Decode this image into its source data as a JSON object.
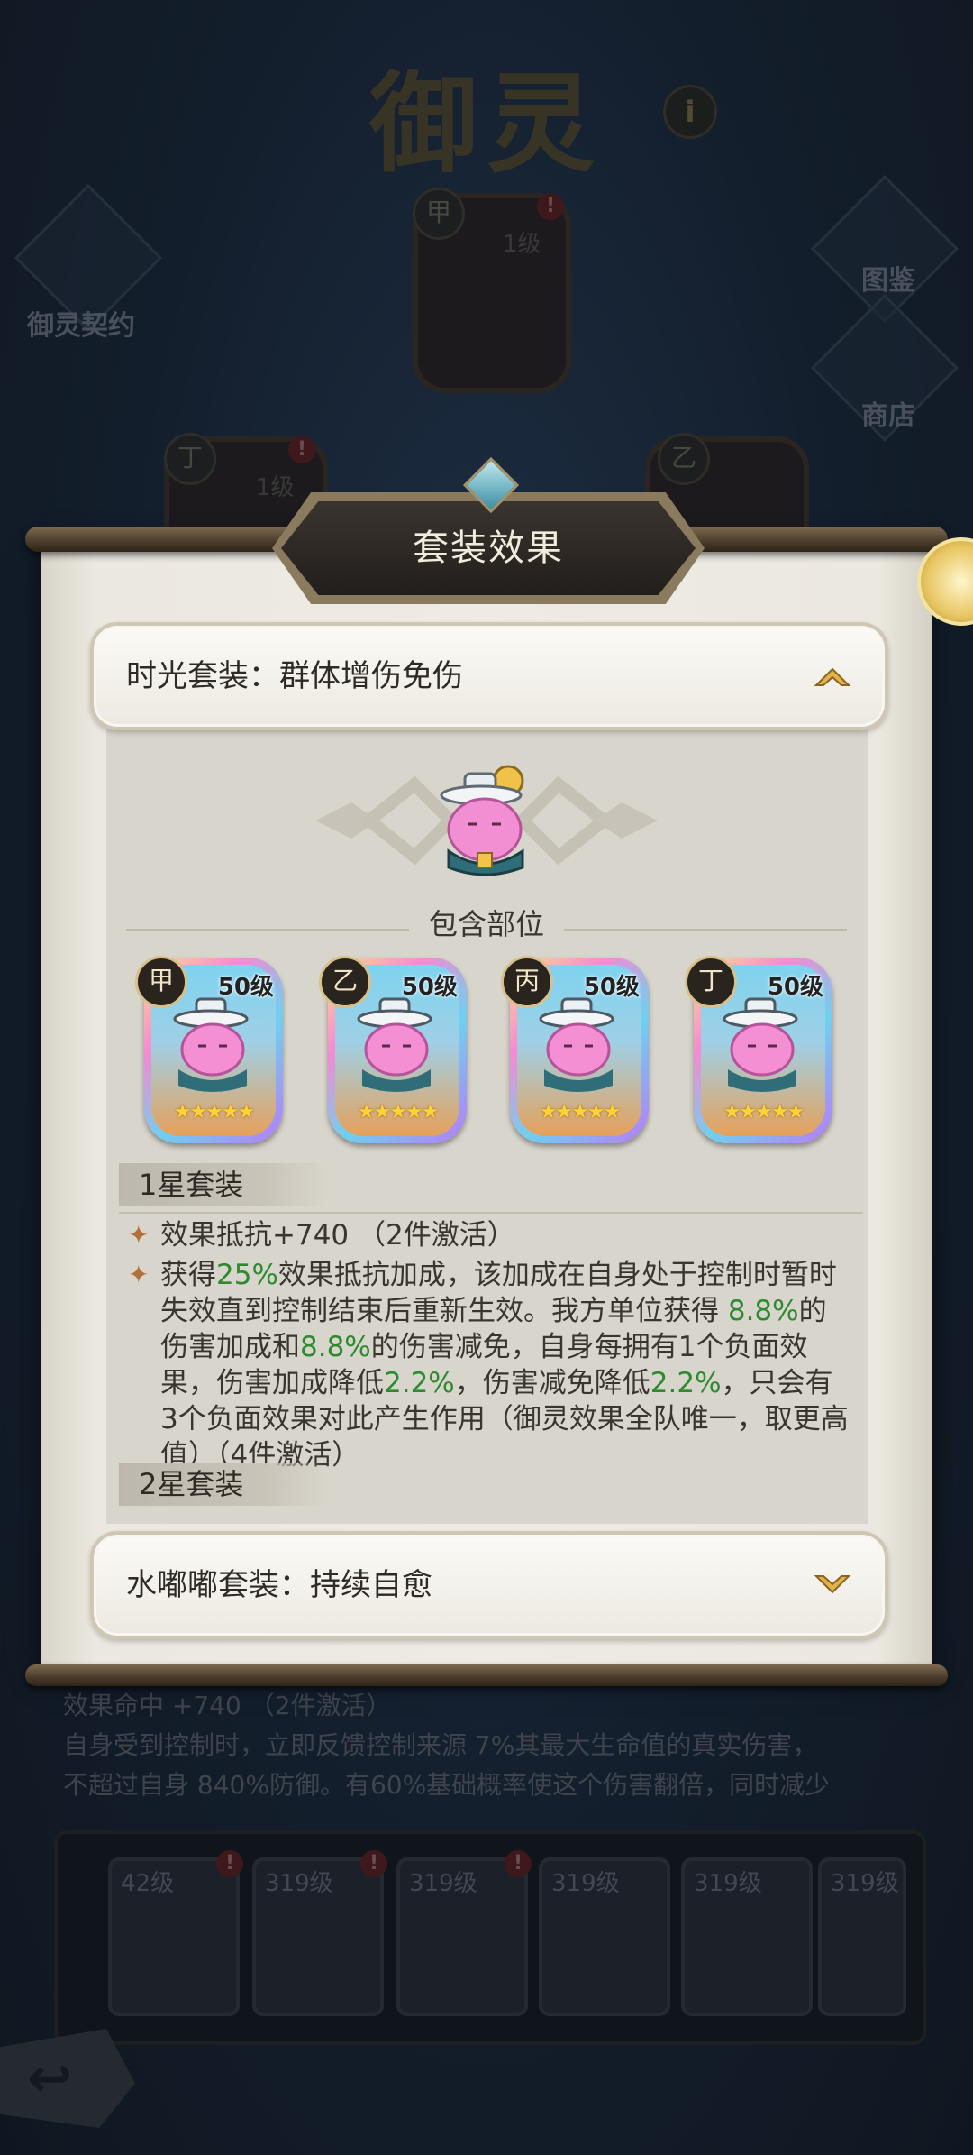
{
  "background": {
    "title": "御灵",
    "info_icon": "info-icon",
    "left_side": {
      "label": "御灵契约"
    },
    "right_side": [
      {
        "label": "图鉴",
        "icon": "book-icon"
      },
      {
        "label": "商店",
        "icon": "bag-icon"
      }
    ],
    "slots": [
      {
        "tag": "甲",
        "level": "1级"
      },
      {
        "tag": "丁",
        "level": "1级"
      },
      {
        "tag": "乙",
        "level": ""
      }
    ],
    "lower_lines": [
      "效果命中 +740 （2件激活）",
      "自身受到控制时，立即反馈控制来源 7%其最大生命值的真实伤害，",
      "不超过自身 840%防御。有60%基础概率使这个伤害翻倍，同时减少"
    ],
    "tray": [
      {
        "level": "42级",
        "badge": "!"
      },
      {
        "level": "319级",
        "badge": "!"
      },
      {
        "level": "319级",
        "badge": "!"
      },
      {
        "level": "319级",
        "badge": ""
      },
      {
        "level": "319级",
        "badge": ""
      },
      {
        "level": "319级",
        "badge": ""
      }
    ]
  },
  "dialog": {
    "title": "套装效果",
    "set1": {
      "name": "时光套装：群体增伤免伤",
      "state": "expanded"
    },
    "contains_label": "包含部位",
    "pieces": [
      {
        "tag": "甲",
        "level": "50级",
        "stars": "★★★★★"
      },
      {
        "tag": "乙",
        "level": "50级",
        "stars": "★★★★★"
      },
      {
        "tag": "丙",
        "level": "50级",
        "stars": "★★★★★"
      },
      {
        "tag": "丁",
        "level": "50级",
        "stars": "★★★★★"
      }
    ],
    "star1_header": "1星套装",
    "effect1": "效果抵抗+740 （2件激活）",
    "effect2": {
      "t1": "获得",
      "g1": "25%",
      "t2": "效果抵抗加成，该加成在自身处于控制时暂时失效直到控制结束后重新生效。我方单位获得 ",
      "g2": "8.8%",
      "t3": "的伤害加成和",
      "g3": "8.8%",
      "t4": "的伤害减免，自身每拥有1个负面效果，伤害加成降低",
      "g4": "2.2%",
      "t5": "，伤害减免降低",
      "g5": "2.2%",
      "t6": "，只会有3个负面效果对此产生作用（御灵效果全队唯一，取更高值）（4件激活）"
    },
    "star2_header": "2星套装",
    "set2": {
      "name": "水嘟嘟套装：持续自愈",
      "state": "collapsed"
    }
  },
  "colors": {
    "highlight_green": "#2e8a2e",
    "paper": "#eeebe4",
    "title_plate": "#2a2521"
  }
}
